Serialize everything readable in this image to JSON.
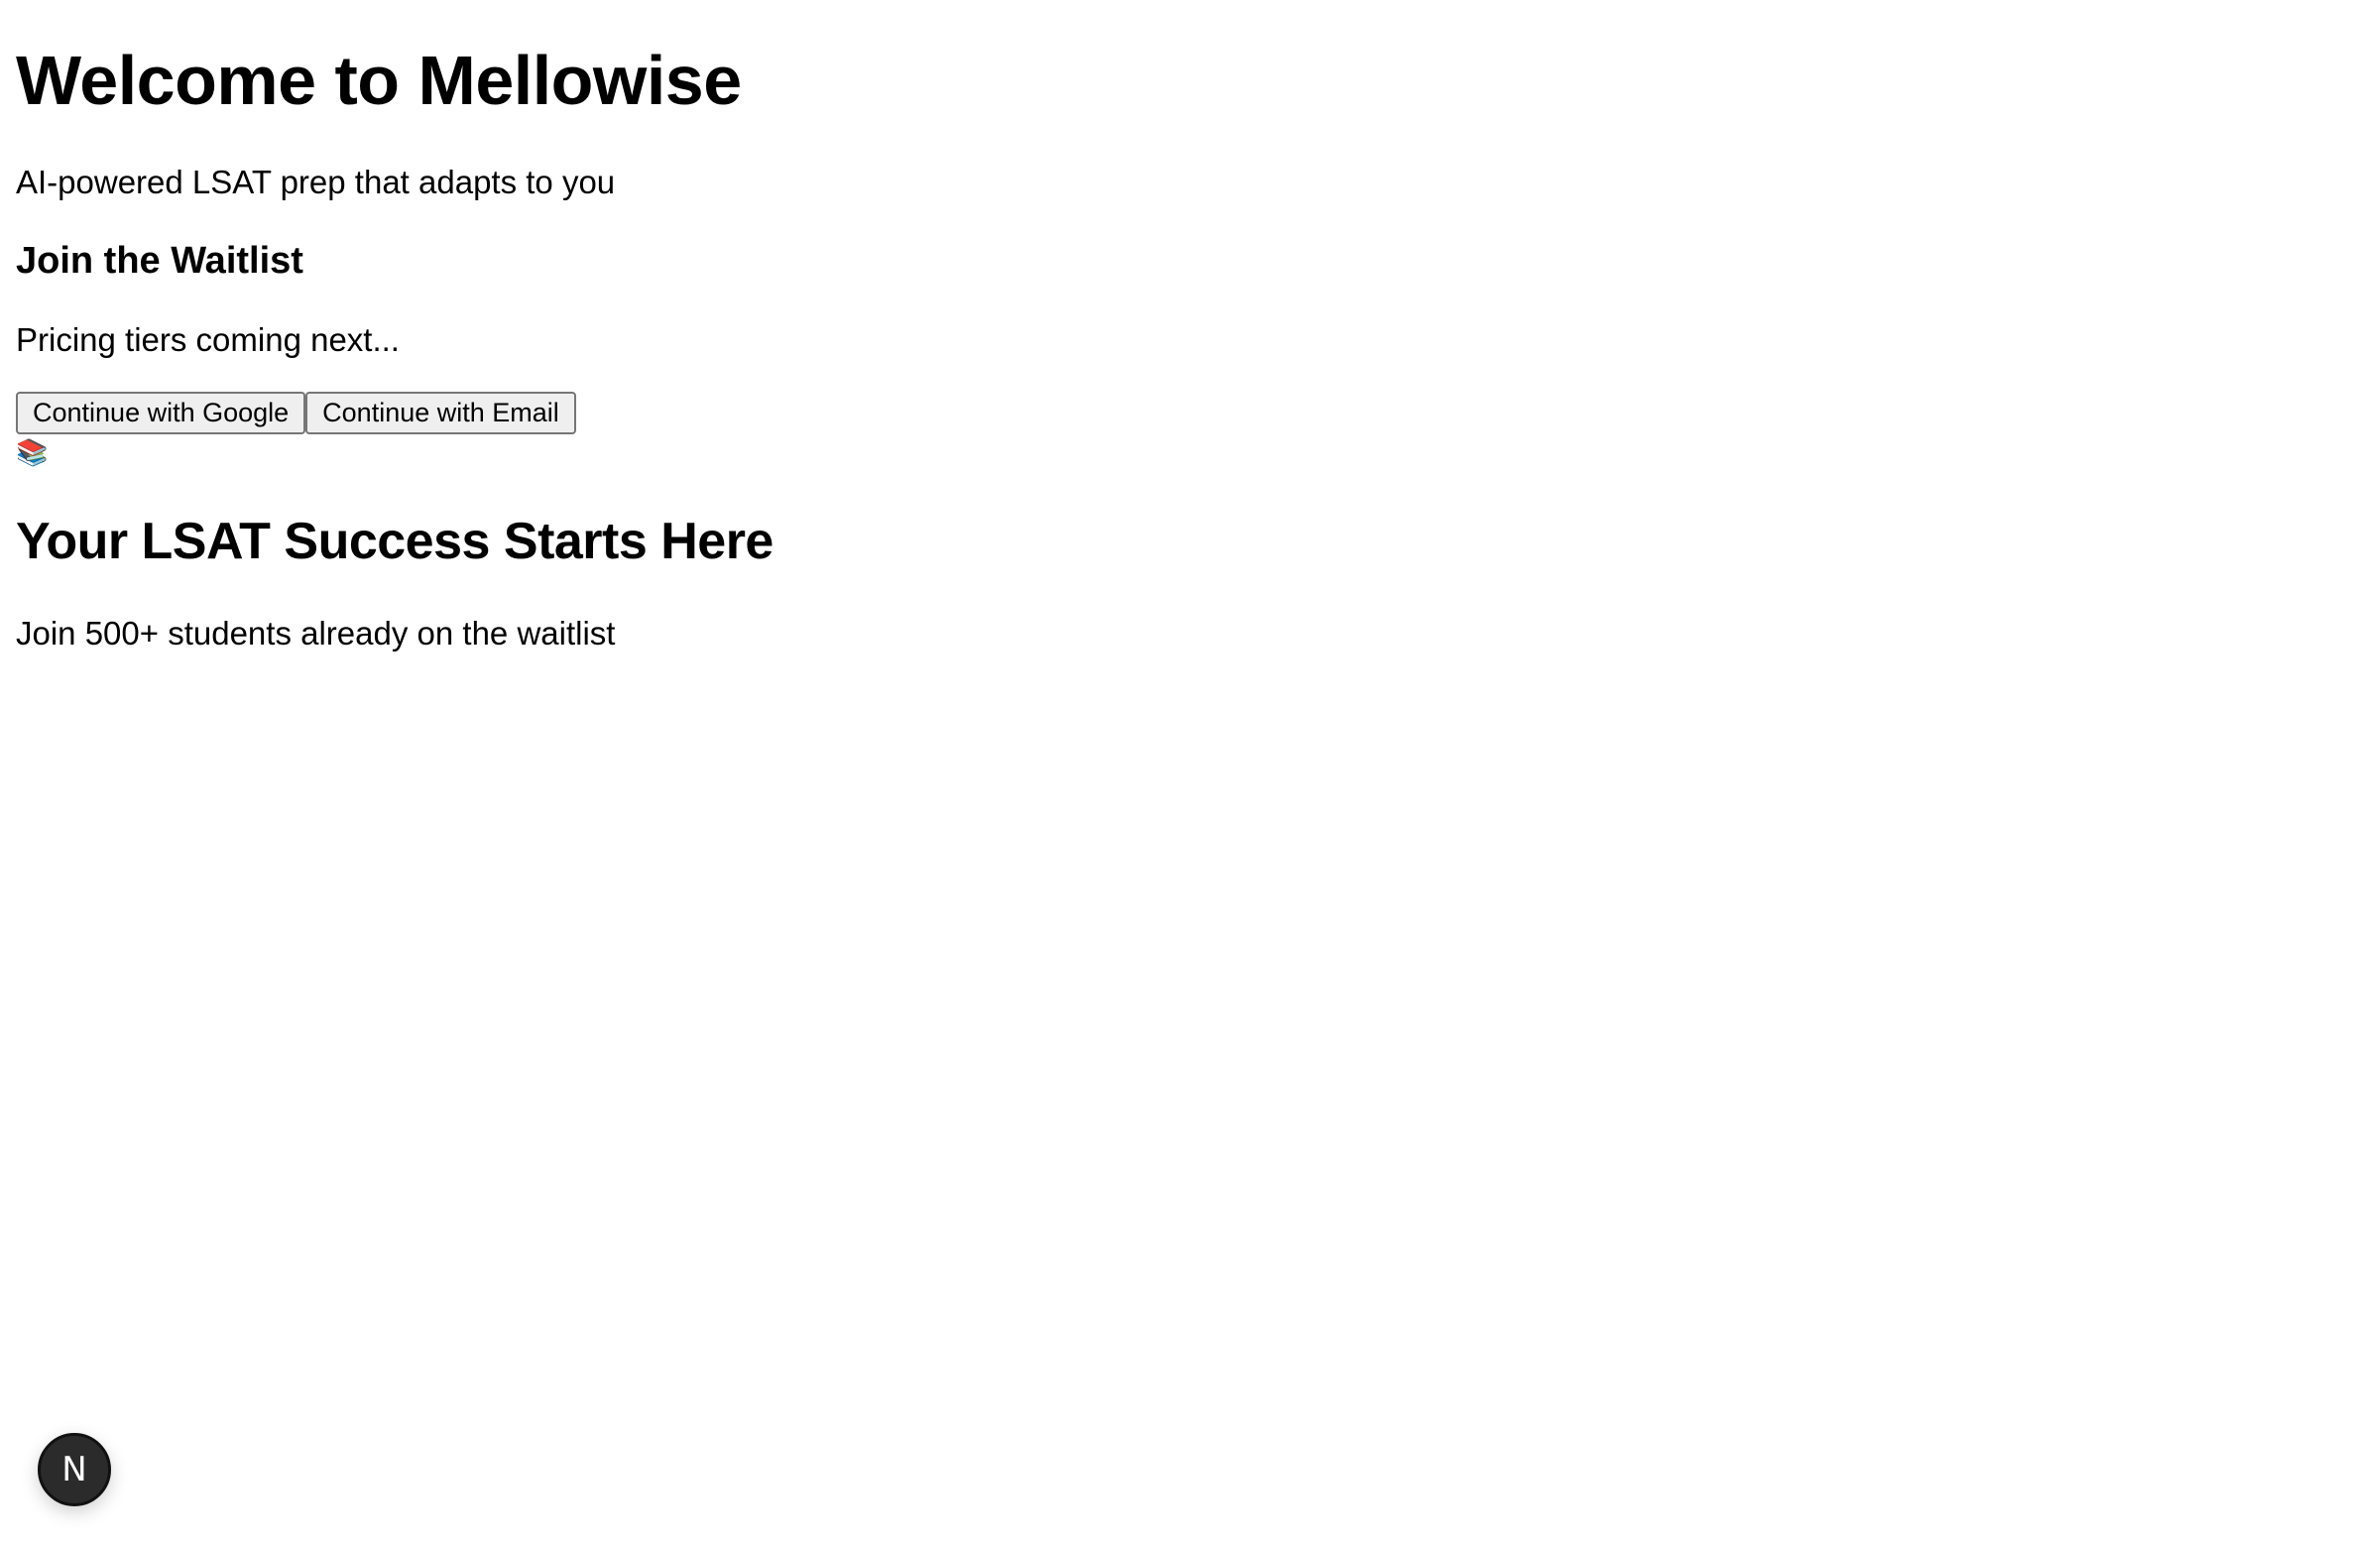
{
  "hero": {
    "title": "Welcome to Mellowise",
    "subtitle": "AI-powered LSAT prep that adapts to you"
  },
  "waitlist": {
    "heading": "Join the Waitlist",
    "pricing_note": "Pricing tiers coming next...",
    "google_button": "Continue with Google",
    "email_button": "Continue with Email",
    "icon": "books-icon",
    "icon_glyph": "📚"
  },
  "footer_section": {
    "heading": "Your LSAT Success Starts Here",
    "social_proof": "Join 500+ students already on the waitlist"
  },
  "devtools": {
    "label": "N",
    "icon": "nextjs-devtools-icon"
  }
}
